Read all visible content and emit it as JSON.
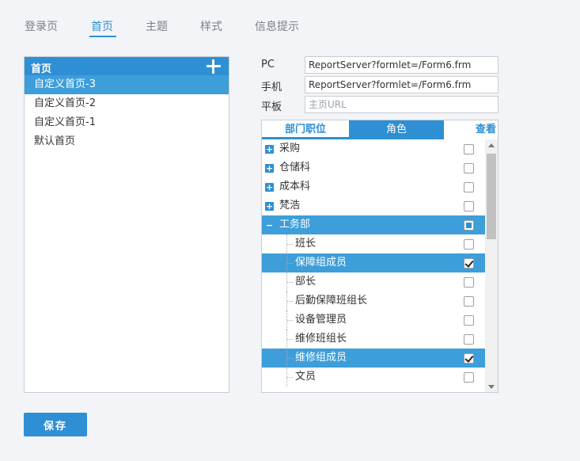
{
  "top_tabs": [
    {
      "label": "登录页"
    },
    {
      "label": "首页"
    },
    {
      "label": "主题"
    },
    {
      "label": "样式"
    },
    {
      "label": "信息提示"
    }
  ],
  "active_tab": "首页",
  "home_panel": {
    "title": "首页",
    "add_icon": "plus-icon",
    "items": [
      {
        "label": "自定义首页-3",
        "selected": true
      },
      {
        "label": "自定义首页-2",
        "selected": false
      },
      {
        "label": "自定义首页-1",
        "selected": false
      },
      {
        "label": "默认首页",
        "selected": false
      }
    ]
  },
  "urls": {
    "pc": {
      "label": "PC",
      "value": "ReportServer?formlet=/Form6.frm",
      "placeholder": ""
    },
    "mobile": {
      "label": "手机",
      "value": "ReportServer?formlet=/Form6.frm",
      "placeholder": ""
    },
    "tablet": {
      "label": "平板",
      "value": "",
      "placeholder": "主页URL"
    }
  },
  "permission_tabs": [
    {
      "label": "部门职位"
    },
    {
      "label": "角色"
    },
    {
      "label": "查看"
    }
  ],
  "tree": [
    {
      "label": "采购",
      "expander": "+",
      "checked": false,
      "selected": false,
      "child": false
    },
    {
      "label": "仓储科",
      "expander": "+",
      "checked": false,
      "selected": false,
      "child": false
    },
    {
      "label": "成本科",
      "expander": "+",
      "checked": false,
      "selected": false,
      "child": false
    },
    {
      "label": "梵浩",
      "expander": "+",
      "checked": false,
      "selected": false,
      "child": false
    },
    {
      "label": "工务部",
      "expander": "−",
      "checked": "partial",
      "selected": true,
      "child": false
    },
    {
      "label": "班长",
      "expander": "",
      "checked": false,
      "selected": false,
      "child": true
    },
    {
      "label": "保障组成员",
      "expander": "",
      "checked": true,
      "selected": true,
      "child": true
    },
    {
      "label": "部长",
      "expander": "",
      "checked": false,
      "selected": false,
      "child": true
    },
    {
      "label": "后勤保障班组长",
      "expander": "",
      "checked": false,
      "selected": false,
      "child": true
    },
    {
      "label": "设备管理员",
      "expander": "",
      "checked": false,
      "selected": false,
      "child": true
    },
    {
      "label": "维修班组长",
      "expander": "",
      "checked": false,
      "selected": false,
      "child": true
    },
    {
      "label": "维修组成员",
      "expander": "",
      "checked": true,
      "selected": true,
      "child": true
    },
    {
      "label": "文员",
      "expander": "",
      "checked": false,
      "selected": false,
      "child": true
    }
  ],
  "save_label": "保存",
  "colors": {
    "accent": "#2e8fd4",
    "selected_row": "#3d9ed9"
  }
}
